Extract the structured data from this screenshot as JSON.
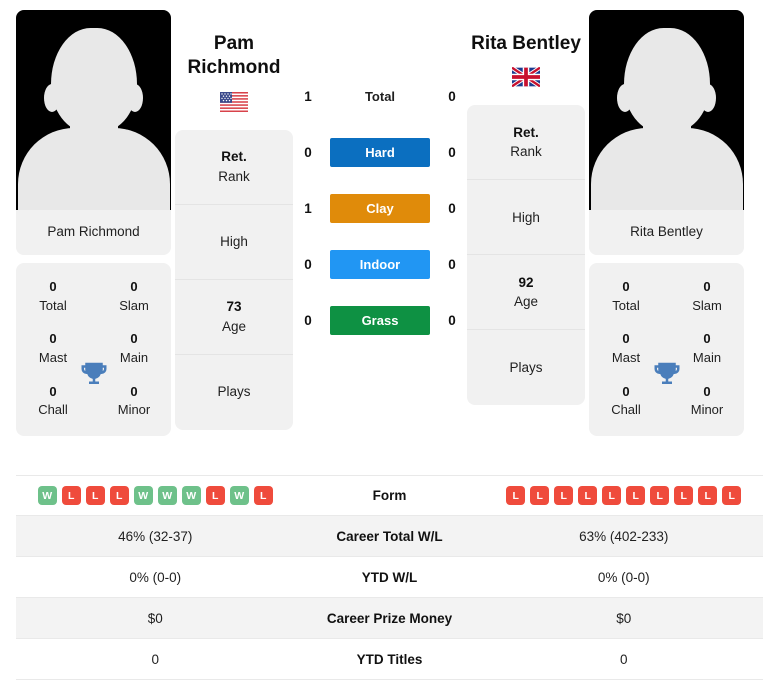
{
  "players": {
    "left": {
      "name": "Pam Richmond",
      "name_line1": "Pam",
      "name_line2": "Richmond",
      "flag": "us-flag-icon",
      "flag_alt": "United States",
      "titles": [
        [
          {
            "value": "0",
            "label": "Total"
          },
          {
            "value": "0",
            "label": "Slam"
          }
        ],
        [
          {
            "value": "0",
            "label": "Mast"
          },
          {
            "value": "0",
            "label": "Main"
          }
        ],
        [
          {
            "value": "0",
            "label": "Chall"
          },
          {
            "value": "0",
            "label": "Minor"
          }
        ]
      ],
      "meta": [
        {
          "value": "Ret.",
          "label": "Rank"
        },
        {
          "value": "",
          "label": "High"
        },
        {
          "value": "73",
          "label": "Age"
        },
        {
          "value": "",
          "label": "Plays"
        }
      ],
      "form": [
        "W",
        "L",
        "L",
        "L",
        "W",
        "W",
        "W",
        "L",
        "W",
        "L"
      ],
      "career_total_wl": "46% (32-37)",
      "ytd_wl": "0% (0-0)",
      "career_prize_money": "$0",
      "ytd_titles": "0"
    },
    "right": {
      "name": "Rita Bentley",
      "name_line1": "Rita Bentley",
      "name_line2": "",
      "flag": "gb-flag-icon",
      "flag_alt": "United Kingdom",
      "titles": [
        [
          {
            "value": "0",
            "label": "Total"
          },
          {
            "value": "0",
            "label": "Slam"
          }
        ],
        [
          {
            "value": "0",
            "label": "Mast"
          },
          {
            "value": "0",
            "label": "Main"
          }
        ],
        [
          {
            "value": "0",
            "label": "Chall"
          },
          {
            "value": "0",
            "label": "Minor"
          }
        ]
      ],
      "meta": [
        {
          "value": "Ret.",
          "label": "Rank"
        },
        {
          "value": "",
          "label": "High"
        },
        {
          "value": "92",
          "label": "Age"
        },
        {
          "value": "",
          "label": "Plays"
        }
      ],
      "form": [
        "L",
        "L",
        "L",
        "L",
        "L",
        "L",
        "L",
        "L",
        "L",
        "L"
      ],
      "career_total_wl": "63% (402-233)",
      "ytd_wl": "0% (0-0)",
      "career_prize_money": "$0",
      "ytd_titles": "0"
    }
  },
  "surfaces": [
    {
      "label": "Total",
      "left": "1",
      "right": "0",
      "color": "",
      "plain": true
    },
    {
      "label": "Hard",
      "left": "0",
      "right": "0",
      "color": "#0b6fc0",
      "plain": false
    },
    {
      "label": "Clay",
      "left": "1",
      "right": "0",
      "color": "#e08b0a",
      "plain": false
    },
    {
      "label": "Indoor",
      "left": "0",
      "right": "0",
      "color": "#2196f3",
      "plain": false
    },
    {
      "label": "Grass",
      "left": "0",
      "right": "0",
      "color": "#0e9143",
      "plain": false
    }
  ],
  "stats_table": [
    {
      "label": "Form",
      "kind": "form",
      "shaded": false
    },
    {
      "label": "Career Total W/L",
      "kind": "text",
      "shaded": true,
      "left": "46% (32-37)",
      "right": "63% (402-233)"
    },
    {
      "label": "YTD W/L",
      "kind": "text",
      "shaded": false,
      "left": "0% (0-0)",
      "right": "0% (0-0)"
    },
    {
      "label": "Career Prize Money",
      "kind": "text",
      "shaded": true,
      "left": "$0",
      "right": "$0"
    },
    {
      "label": "YTD Titles",
      "kind": "text",
      "shaded": false,
      "left": "0",
      "right": "0"
    }
  ],
  "colors": {
    "hard": "#0b6fc0",
    "clay": "#e08b0a",
    "indoor": "#2196f3",
    "grass": "#0e9143",
    "win": "#6ec18a",
    "loss": "#ef4b3c",
    "trophy": "#4a7ebb",
    "card_bg": "#f1f1f1",
    "row_shaded": "#f3f3f3"
  },
  "icons": {
    "trophy": "trophy-icon"
  }
}
